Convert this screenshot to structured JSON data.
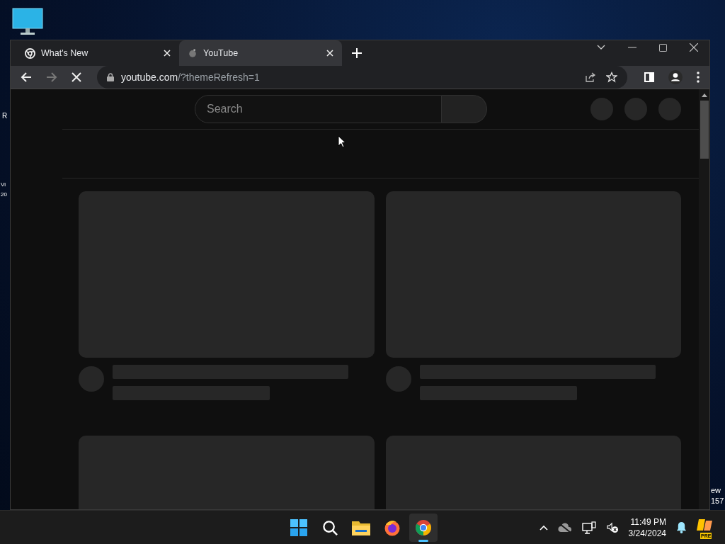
{
  "desktop": {
    "text_fragments": [
      {
        "text": "R"
      },
      {
        "text": "Vi\n20"
      },
      {
        "text": "ew\n157"
      }
    ]
  },
  "browser": {
    "tabs": [
      {
        "title": "What's New",
        "selected": false,
        "loading": false
      },
      {
        "title": "YouTube",
        "selected": true,
        "loading": true
      }
    ],
    "back": {
      "disabled": false
    },
    "forward": {
      "disabled": true
    },
    "loading": true,
    "address": {
      "host": "youtube.com",
      "path": "/?themeRefresh=1"
    }
  },
  "page": {
    "search": {
      "placeholder": "Search"
    },
    "feed": [
      {
        "kind": "video-skeleton"
      },
      {
        "kind": "video-skeleton"
      },
      {
        "kind": "thumbnail-only"
      },
      {
        "kind": "thumbnail-only"
      }
    ]
  },
  "taskbar": {
    "apps": [
      {
        "kind": "start",
        "selected": false
      },
      {
        "kind": "search",
        "selected": false
      },
      {
        "kind": "files",
        "selected": false
      },
      {
        "kind": "firefox",
        "selected": false
      },
      {
        "kind": "chrome",
        "selected": true
      }
    ],
    "time": "11:49 PM",
    "date": "3/24/2024",
    "badge": "PRE"
  }
}
